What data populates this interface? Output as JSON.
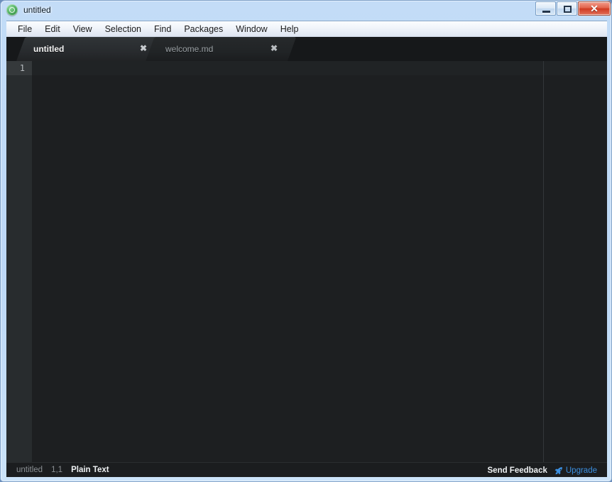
{
  "window": {
    "title": "untitled",
    "icon": "atom-logo-icon",
    "controls": {
      "minimize_label": "—",
      "maximize_label": "□",
      "close_label": "✕"
    }
  },
  "menubar": {
    "items": [
      {
        "label": "File"
      },
      {
        "label": "Edit"
      },
      {
        "label": "View"
      },
      {
        "label": "Selection"
      },
      {
        "label": "Find"
      },
      {
        "label": "Packages"
      },
      {
        "label": "Window"
      },
      {
        "label": "Help"
      }
    ]
  },
  "tabs": [
    {
      "label": "untitled",
      "active": true,
      "close_label": "✖"
    },
    {
      "label": "welcome.md",
      "active": false,
      "close_label": "✖"
    }
  ],
  "editor": {
    "line_numbers": [
      "1"
    ],
    "content": "",
    "wrap_guide_visible": true
  },
  "statusbar": {
    "file_name": "untitled",
    "cursor_position": "1,1",
    "grammar": "Plain Text",
    "send_feedback_label": "Send Feedback",
    "upgrade_label": "Upgrade",
    "upgrade_icon": "rocket-icon"
  },
  "colors": {
    "editor_background": "#1d1f21",
    "gutter_background": "#282c2e",
    "tabbar_background": "#16181a",
    "statusbar_background": "#1b1d1f",
    "accent_link": "#3b8fe0",
    "titlebar_aero": "#bdd8f6",
    "close_button_red": "#cf3b22"
  }
}
